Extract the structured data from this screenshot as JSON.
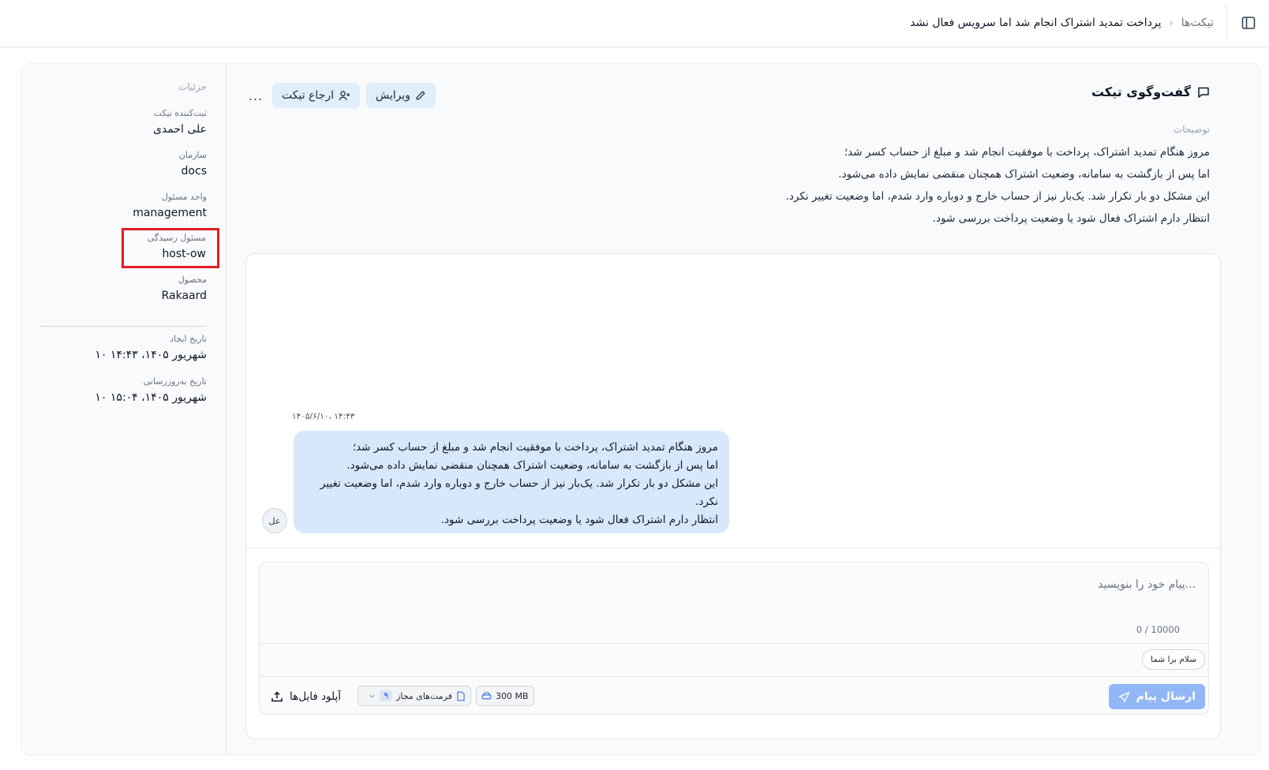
{
  "header": {
    "breadcrumb_root": "تیکت‌ها",
    "breadcrumb_separator": "›",
    "breadcrumb_current": "پرداخت تمدید اشتراک انجام شد اما سرویس فعال نشد",
    "toggle_icon": "sidebar-toggle-icon"
  },
  "details": {
    "title": "جزئیات",
    "fields": [
      {
        "label": "ثبت‌کننده تیکت",
        "value": "علی احمدی"
      },
      {
        "label": "سازمان",
        "value": "docs"
      },
      {
        "label": "واحد مسئول",
        "value": "management"
      },
      {
        "label": "مسئول رسیدگی",
        "value": "host-ow"
      },
      {
        "label": "محصول",
        "value": "Rakaard"
      },
      {
        "label": "تاریخ ایجاد",
        "value": "۱۰ شهریور ۱۴۰۵، ۱۴:۴۳"
      },
      {
        "label": "تاریخ به‌روزرسانی",
        "value": "۱۰ شهریور ۱۴۰۵، ۱۵:۰۴"
      }
    ]
  },
  "conversation": {
    "title": "گفت‌وگوی تیکت",
    "actions": {
      "edit_label": "ویرایش",
      "refer_label": "ارجاع تیکت",
      "more_label": "..."
    },
    "description_label": "توضیحات",
    "description_lines": [
      "مروز هنگام تمدید اشتراک، پرداخت با موفقیت انجام شد و مبلغ از حساب کسر شد؛",
      "اما پس از بازگشت به سامانه، وضعیت اشتراک همچنان منقضی نمایش داده می‌شود.",
      "این مشکل دو بار تکرار شد. یک‌بار نیز از حساب خارج و دوباره وارد شدم، اما وضعیت تغییر نکرد.",
      "انتظار دارم اشتراک فعال شود یا وضعیت پرداخت بررسی شود."
    ],
    "message": {
      "timestamp": "۱۴۰۵/۶/۱۰، ۱۴:۴۳",
      "avatar": "عل",
      "lines": [
        "مروز هنگام تمدید اشتراک، پرداخت با موفقیت انجام شد و مبلغ از حساب کسر شد؛",
        "اما پس از بازگشت به سامانه، وضعیت اشتراک همچنان منقضی نمایش داده می‌شود.",
        "این مشکل دو بار تکرار شد. یک‌بار نیز از حساب خارج و دوباره وارد شدم، اما وضعیت تغییر نکرد.",
        "انتظار دارم اشتراک فعال شود یا وضعیت پرداخت بررسی شود."
      ]
    },
    "composer": {
      "placeholder": "...پیام خود را بنویسید",
      "value": "",
      "char_count": "0 / 10000",
      "quick_reply": "سلام برا شما",
      "send_label": "ارسال پیام",
      "upload_label": "آپلود فایل‌ها",
      "formats_label": "فرمت‌های مجاز",
      "formats_count": "۹",
      "max_size": "300 MB"
    }
  },
  "colors": {
    "accent_soft": "#e0edfb",
    "bubble": "#d8e8fb",
    "send_disabled": "#93b6f6",
    "highlight_box": "#e11d24"
  }
}
